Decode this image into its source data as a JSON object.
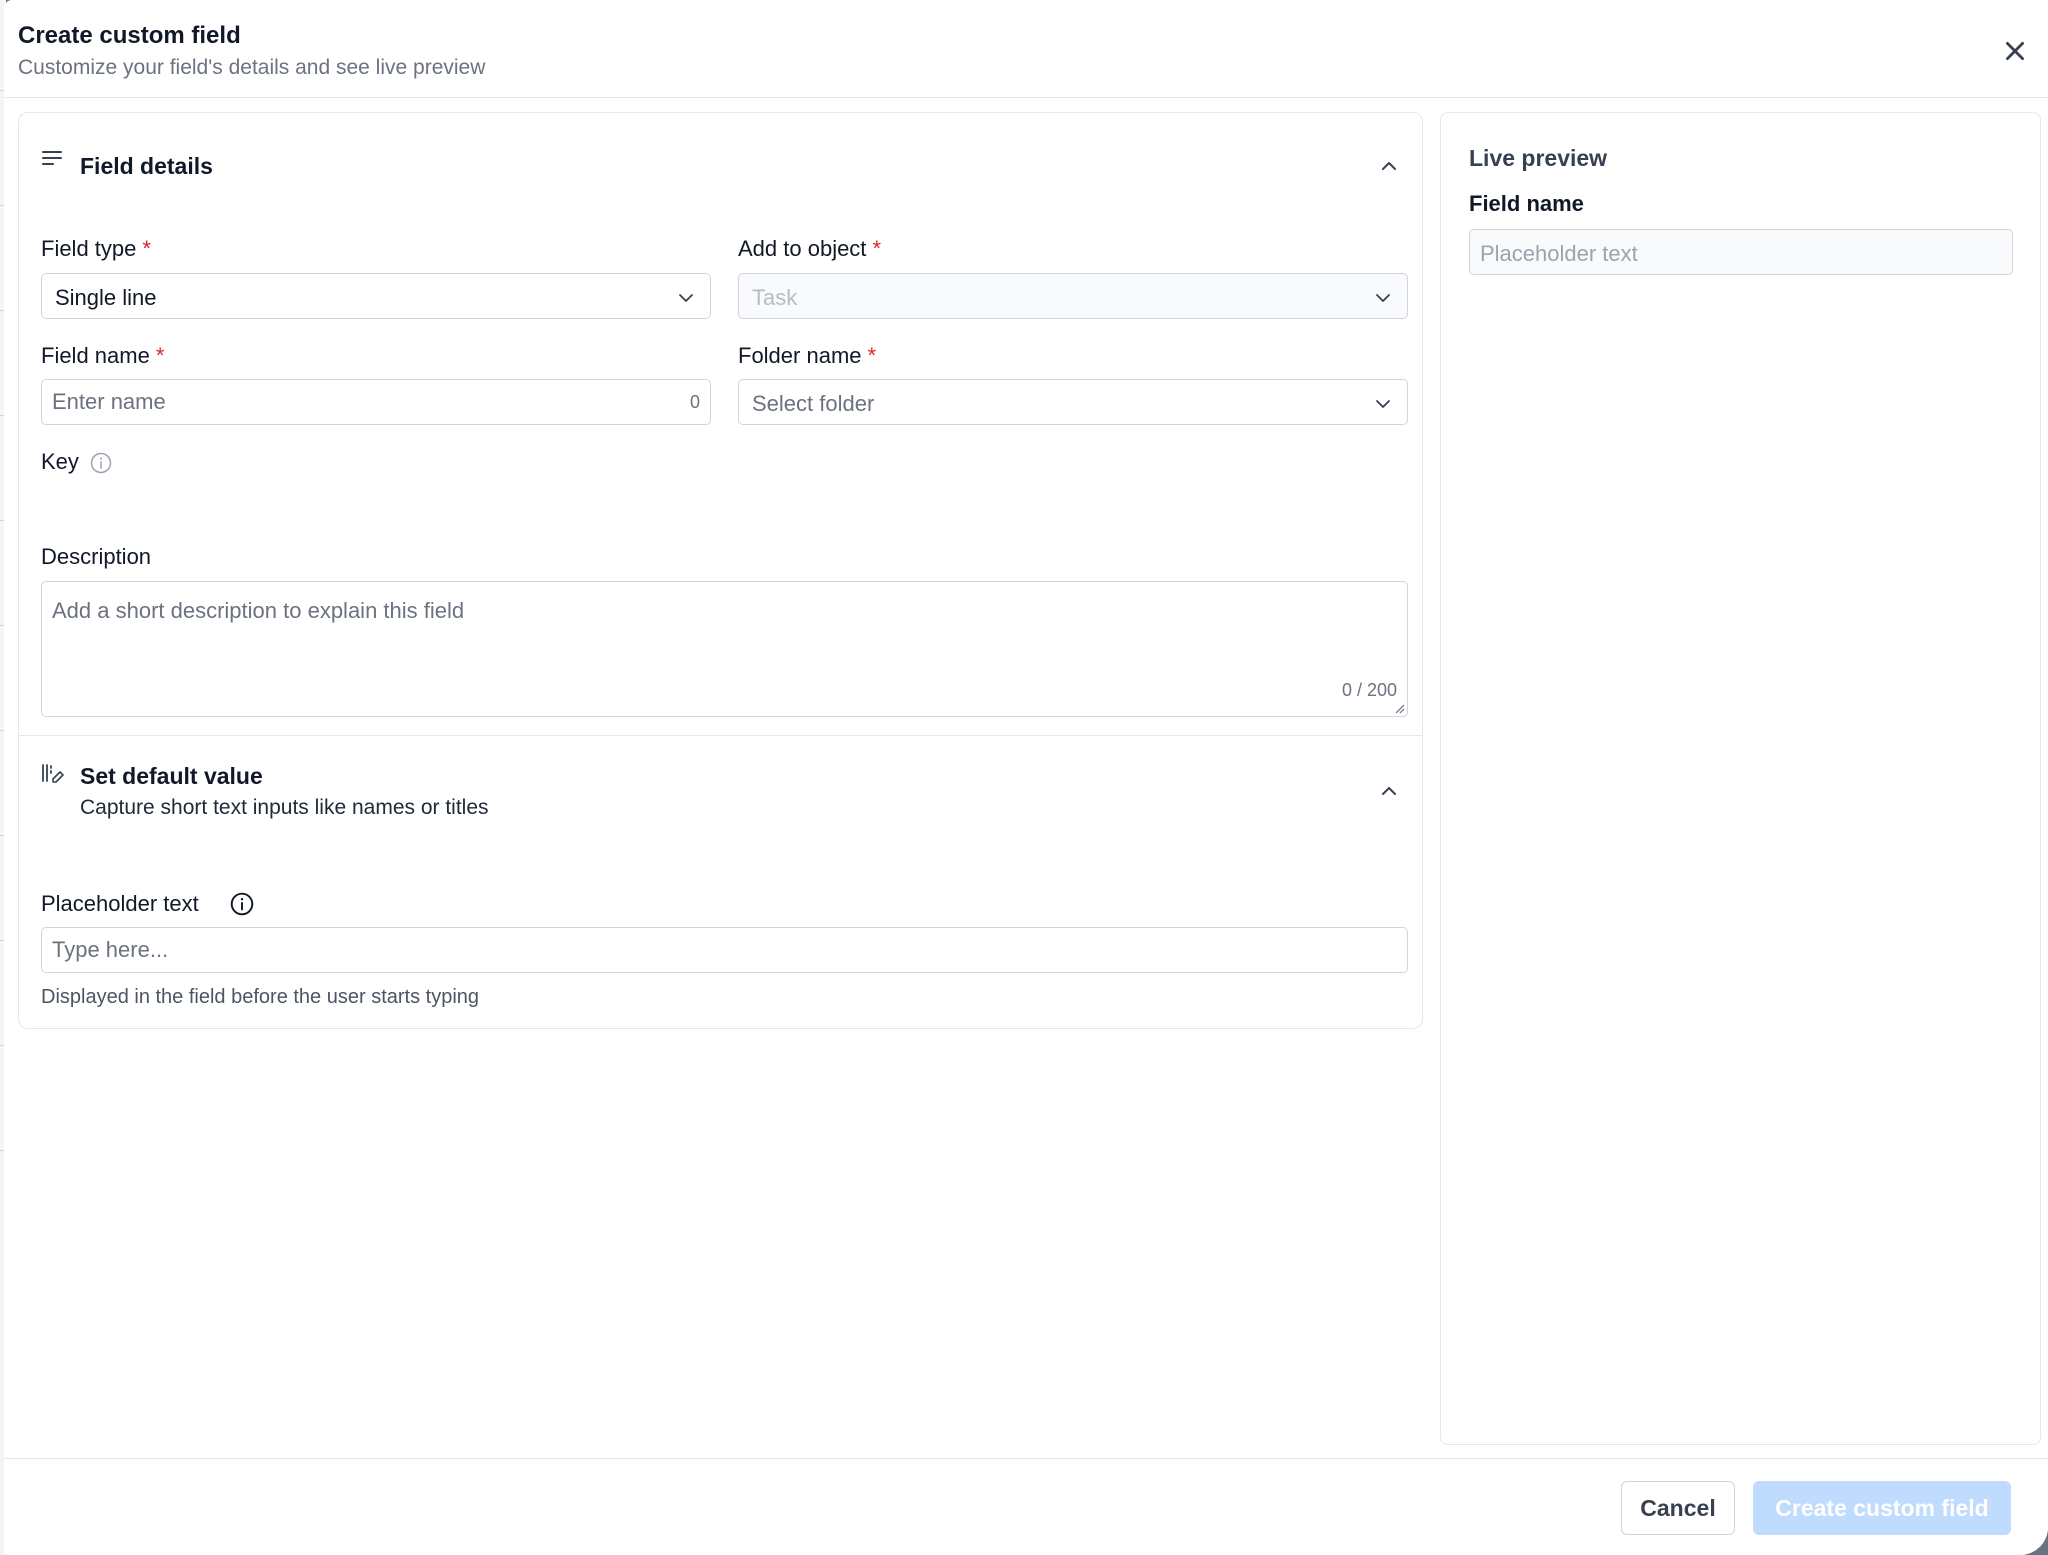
{
  "modal": {
    "title": "Create custom field",
    "subtitle": "Customize your field's details and see live preview"
  },
  "field_details": {
    "title": "Field details",
    "field_type": {
      "label": "Field type",
      "required_mark": "*",
      "value": "Single line"
    },
    "add_to_object": {
      "label": "Add to object",
      "required_mark": "*",
      "value": "Task"
    },
    "field_name": {
      "label": "Field name",
      "required_mark": "*",
      "placeholder": "Enter name",
      "count": "0"
    },
    "folder_name": {
      "label": "Folder name",
      "required_mark": "*",
      "placeholder": "Select folder"
    },
    "key": {
      "label": "Key"
    },
    "description": {
      "label": "Description",
      "placeholder": "Add a short description to explain this field",
      "count": "0 / 200"
    }
  },
  "default_value": {
    "title": "Set default value",
    "subtitle": "Capture short text inputs like names or titles",
    "placeholder_text": {
      "label": "Placeholder text",
      "placeholder": "Type here...",
      "helper": "Displayed in the field before the user starts typing"
    }
  },
  "live_preview": {
    "title": "Live preview",
    "field_label": "Field name",
    "input_placeholder": "Placeholder text"
  },
  "footer": {
    "cancel_label": "Cancel",
    "create_label": "Create custom field"
  },
  "colors": {
    "required": "#dc2626",
    "primary_disabled": "#bfdbfe",
    "border": "#d1d5db"
  }
}
